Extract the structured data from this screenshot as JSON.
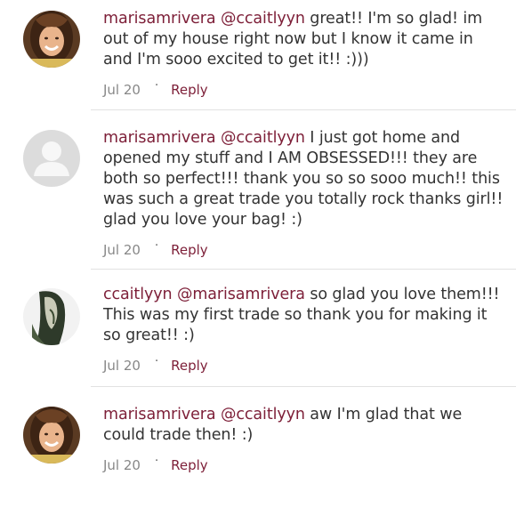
{
  "comments": [
    {
      "author": "marisamrivera",
      "mention": "@ccaitlyyn",
      "text": " great!! I'm so glad! im out of my house right now but I know it came in and I'm sooo excited to get it!! :)))",
      "date": "Jul 20",
      "separator": "·",
      "reply_label": "Reply",
      "avatar": "user-photo-icon"
    },
    {
      "author": "marisamrivera",
      "mention": "@ccaitlyyn",
      "text": " I just got home and opened my stuff and I AM OBSESSED!!! they are both so perfect!!! thank you so so sooo much!! this was such a great trade you totally rock thanks girl!! glad you love your bag! :)",
      "date": "Jul 20",
      "separator": "·",
      "reply_label": "Reply",
      "avatar": "default-user-icon"
    },
    {
      "author": "ccaitlyyn",
      "mention": "@marisamrivera",
      "text": " so glad you love them!!! This was my first trade so thank you for making it so great!! :)",
      "date": "Jul 20",
      "separator": "·",
      "reply_label": "Reply",
      "avatar": "user-photo-icon"
    },
    {
      "author": "marisamrivera",
      "mention": "@ccaitlyyn",
      "text": " aw I'm glad that we could trade then! :)",
      "date": "Jul 20",
      "separator": "·",
      "reply_label": "Reply",
      "avatar": "user-photo-icon"
    }
  ],
  "colors": {
    "link": "#7d1f38",
    "text": "#333333",
    "meta": "#888888",
    "divider": "#e2e2e2"
  }
}
